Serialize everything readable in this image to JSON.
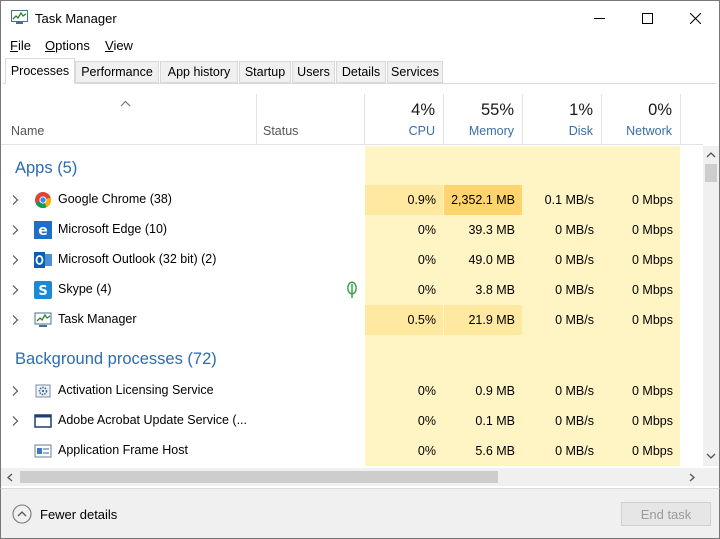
{
  "window": {
    "title": "Task Manager"
  },
  "menu": {
    "file": {
      "mnemonic": "F",
      "rest": "ile"
    },
    "options": {
      "mnemonic": "O",
      "rest": "ptions"
    },
    "view": {
      "mnemonic": "V",
      "rest": "iew"
    }
  },
  "tabs": [
    "Processes",
    "Performance",
    "App history",
    "Startup",
    "Users",
    "Details",
    "Services"
  ],
  "active_tab": "Processes",
  "columns": {
    "name": "Name",
    "status": "Status",
    "cpu": {
      "pct": "4%",
      "label": "CPU"
    },
    "memory": {
      "pct": "55%",
      "label": "Memory"
    },
    "disk": {
      "pct": "1%",
      "label": "Disk"
    },
    "network": {
      "pct": "0%",
      "label": "Network"
    }
  },
  "groups": {
    "apps": "Apps (5)",
    "background": "Background processes (72)"
  },
  "rows": [
    {
      "name": "Google Chrome (38)",
      "icon": "chrome-icon",
      "cpu": "0.9%",
      "memory": "2,352.1 MB",
      "disk": "0.1 MB/s",
      "network": "0 Mbps"
    },
    {
      "name": "Microsoft Edge (10)",
      "icon": "edge-icon",
      "cpu": "0%",
      "memory": "39.3 MB",
      "disk": "0 MB/s",
      "network": "0 Mbps"
    },
    {
      "name": "Microsoft Outlook (32 bit) (2)",
      "icon": "outlook-icon",
      "cpu": "0%",
      "memory": "49.0 MB",
      "disk": "0 MB/s",
      "network": "0 Mbps"
    },
    {
      "name": "Skype (4)",
      "icon": "skype-icon",
      "cpu": "0%",
      "memory": "3.8 MB",
      "disk": "0 MB/s",
      "network": "0 Mbps",
      "status_icon": "leaf-icon"
    },
    {
      "name": "Task Manager",
      "icon": "task-manager-icon",
      "cpu": "0.5%",
      "memory": "21.9 MB",
      "disk": "0 MB/s",
      "network": "0 Mbps"
    },
    {
      "name": "Activation Licensing Service",
      "icon": "gear-service-icon",
      "cpu": "0%",
      "memory": "0.9 MB",
      "disk": "0 MB/s",
      "network": "0 Mbps"
    },
    {
      "name": "Adobe Acrobat Update Service (...",
      "icon": "window-icon",
      "cpu": "0%",
      "memory": "0.1 MB",
      "disk": "0 MB/s",
      "network": "0 Mbps"
    },
    {
      "name": "Application Frame Host",
      "icon": "app-frame-icon",
      "cpu": "0%",
      "memory": "5.6 MB",
      "disk": "0 MB/s",
      "network": "0 Mbps"
    }
  ],
  "footer": {
    "fewer_details": "Fewer details",
    "end_task": "End task"
  },
  "colors": {
    "heat_light": "#fff4c4",
    "heat_medium": "#ffe8a0",
    "heat_high": "#ffd36e",
    "group_blue": "#2b6cb0",
    "metric_blue": "#3a6ea5"
  }
}
